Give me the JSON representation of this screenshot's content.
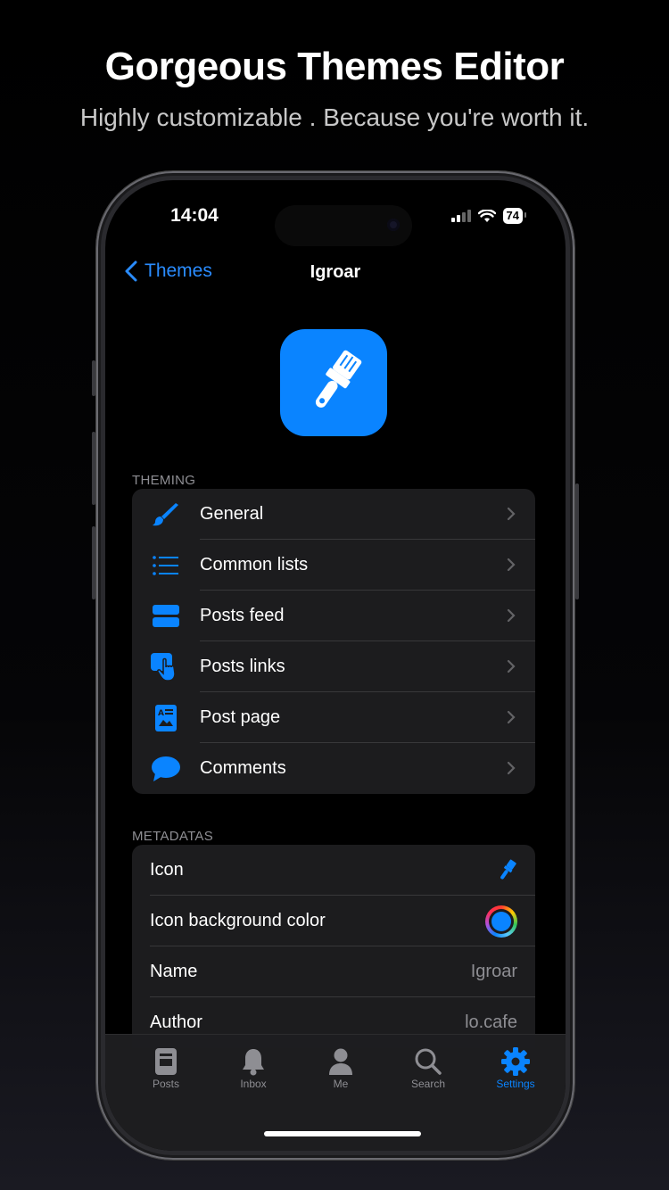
{
  "hero": {
    "title": "Gorgeous Themes Editor",
    "subtitle": "Highly customizable . Because you're worth it."
  },
  "status_bar": {
    "time": "14:04",
    "battery": "74"
  },
  "nav": {
    "back_label": "Themes",
    "title": "Igroar"
  },
  "app_icon": {
    "icon": "paintbrush-icon",
    "background": "#0a84ff"
  },
  "theming": {
    "header": "THEMING",
    "items": [
      {
        "label": "General",
        "icon": "paintbrush-icon"
      },
      {
        "label": "Common lists",
        "icon": "list-icon"
      },
      {
        "label": "Posts feed",
        "icon": "rectangles-icon"
      },
      {
        "label": "Posts links",
        "icon": "hand-pointer-icon"
      },
      {
        "label": "Post page",
        "icon": "document-icon"
      },
      {
        "label": "Comments",
        "icon": "speech-bubble-icon"
      }
    ]
  },
  "metadatas": {
    "header": "METADATAS",
    "items": [
      {
        "label": "Icon",
        "value": ""
      },
      {
        "label": "Icon background color",
        "value": ""
      },
      {
        "label": "Name",
        "value": "Igroar"
      },
      {
        "label": "Author",
        "value": "lo.cafe"
      }
    ]
  },
  "tabbar": {
    "tabs": [
      {
        "label": "Posts",
        "icon": "book-icon"
      },
      {
        "label": "Inbox",
        "icon": "bell-icon"
      },
      {
        "label": "Me",
        "icon": "person-icon"
      },
      {
        "label": "Search",
        "icon": "magnifier-icon"
      },
      {
        "label": "Settings",
        "icon": "gear-icon",
        "active": true
      }
    ]
  },
  "colors": {
    "accent": "#0a84ff",
    "row_bg": "#1c1c1e",
    "secondary_text": "#8e8e93"
  }
}
